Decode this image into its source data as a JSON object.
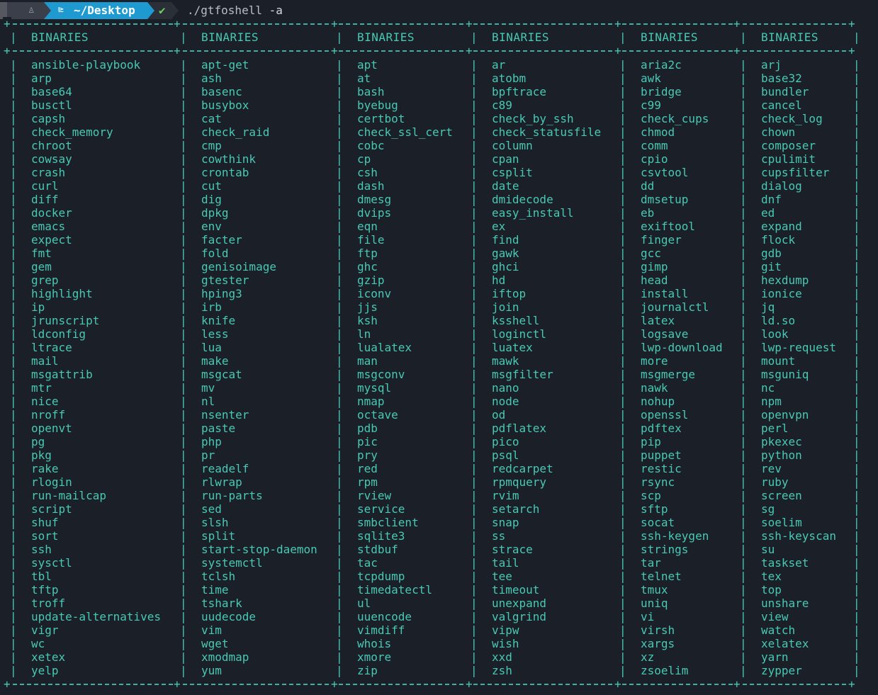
{
  "prompt": {
    "dir": "~/Desktop",
    "status_glyph": "✔",
    "command": "./gtfoshell",
    "args": "-a",
    "accent_color": "#1e9ad0"
  },
  "table": {
    "text_color": "#48c9b5",
    "border_glyphs": "+-|",
    "headers": [
      "BINARIES",
      "BINARIES",
      "BINARIES",
      "BINARIES",
      "BINARIES",
      "BINARIES"
    ],
    "columns": [
      [
        "ansible-playbook",
        "arp",
        "base64",
        "busctl",
        "capsh",
        "check_memory",
        "chroot",
        "cowsay",
        "crash",
        "curl",
        "diff",
        "docker",
        "emacs",
        "expect",
        "fmt",
        "gem",
        "grep",
        "highlight",
        "ip",
        "jrunscript",
        "ldconfig",
        "ltrace",
        "mail",
        "msgattrib",
        "mtr",
        "nice",
        "nroff",
        "openvt",
        "pg",
        "pkg",
        "rake",
        "rlogin",
        "run-mailcap",
        "script",
        "shuf",
        "sort",
        "ssh",
        "sysctl",
        "tbl",
        "tftp",
        "troff",
        "update-alternatives",
        "vigr",
        "wc",
        "xetex",
        "yelp"
      ],
      [
        "apt-get",
        "ash",
        "basenc",
        "busybox",
        "cat",
        "check_raid",
        "cmp",
        "cowthink",
        "crontab",
        "cut",
        "dig",
        "dpkg",
        "env",
        "facter",
        "fold",
        "genisoimage",
        "gtester",
        "hping3",
        "irb",
        "knife",
        "less",
        "lua",
        "make",
        "msgcat",
        "mv",
        "nl",
        "nsenter",
        "paste",
        "php",
        "pr",
        "readelf",
        "rlwrap",
        "run-parts",
        "sed",
        "slsh",
        "split",
        "start-stop-daemon",
        "systemctl",
        "tclsh",
        "time",
        "tshark",
        "uudecode",
        "vim",
        "wget",
        "xmodmap",
        "yum"
      ],
      [
        "apt",
        "at",
        "bash",
        "byebug",
        "certbot",
        "check_ssl_cert",
        "cobc",
        "cp",
        "csh",
        "dash",
        "dmesg",
        "dvips",
        "eqn",
        "file",
        "ftp",
        "ghc",
        "gzip",
        "iconv",
        "jjs",
        "ksh",
        "ln",
        "lualatex",
        "man",
        "msgconv",
        "mysql",
        "nmap",
        "octave",
        "pdb",
        "pic",
        "pry",
        "red",
        "rpm",
        "rview",
        "service",
        "smbclient",
        "sqlite3",
        "stdbuf",
        "tac",
        "tcpdump",
        "timedatectl",
        "ul",
        "uuencode",
        "vimdiff",
        "whois",
        "xmore",
        "zip"
      ],
      [
        "ar",
        "atobm",
        "bpftrace",
        "c89",
        "check_by_ssh",
        "check_statusfile",
        "column",
        "cpan",
        "csplit",
        "date",
        "dmidecode",
        "easy_install",
        "ex",
        "find",
        "gawk",
        "ghci",
        "hd",
        "iftop",
        "join",
        "ksshell",
        "loginctl",
        "luatex",
        "mawk",
        "msgfilter",
        "nano",
        "node",
        "od",
        "pdflatex",
        "pico",
        "psql",
        "redcarpet",
        "rpmquery",
        "rvim",
        "setarch",
        "snap",
        "ss",
        "strace",
        "tail",
        "tee",
        "timeout",
        "unexpand",
        "valgrind",
        "vipw",
        "wish",
        "xxd",
        "zsh"
      ],
      [
        "aria2c",
        "awk",
        "bridge",
        "c99",
        "check_cups",
        "chmod",
        "comm",
        "cpio",
        "csvtool",
        "dd",
        "dmsetup",
        "eb",
        "exiftool",
        "finger",
        "gcc",
        "gimp",
        "head",
        "install",
        "journalctl",
        "latex",
        "logsave",
        "lwp-download",
        "more",
        "msgmerge",
        "nawk",
        "nohup",
        "openssl",
        "pdftex",
        "pip",
        "puppet",
        "restic",
        "rsync",
        "scp",
        "sftp",
        "socat",
        "ssh-keygen",
        "strings",
        "tar",
        "telnet",
        "tmux",
        "uniq",
        "vi",
        "virsh",
        "xargs",
        "xz",
        "zsoelim"
      ],
      [
        "arj",
        "base32",
        "bundler",
        "cancel",
        "check_log",
        "chown",
        "composer",
        "cpulimit",
        "cupsfilter",
        "dialog",
        "dnf",
        "ed",
        "expand",
        "flock",
        "gdb",
        "git",
        "hexdump",
        "ionice",
        "jq",
        "ld.so",
        "look",
        "lwp-request",
        "mount",
        "msguniq",
        "nc",
        "npm",
        "openvpn",
        "perl",
        "pkexec",
        "python",
        "rev",
        "ruby",
        "screen",
        "sg",
        "soelim",
        "ssh-keyscan",
        "su",
        "taskset",
        "tex",
        "top",
        "unshare",
        "view",
        "watch",
        "xelatex",
        "yarn",
        "zypper"
      ]
    ]
  }
}
